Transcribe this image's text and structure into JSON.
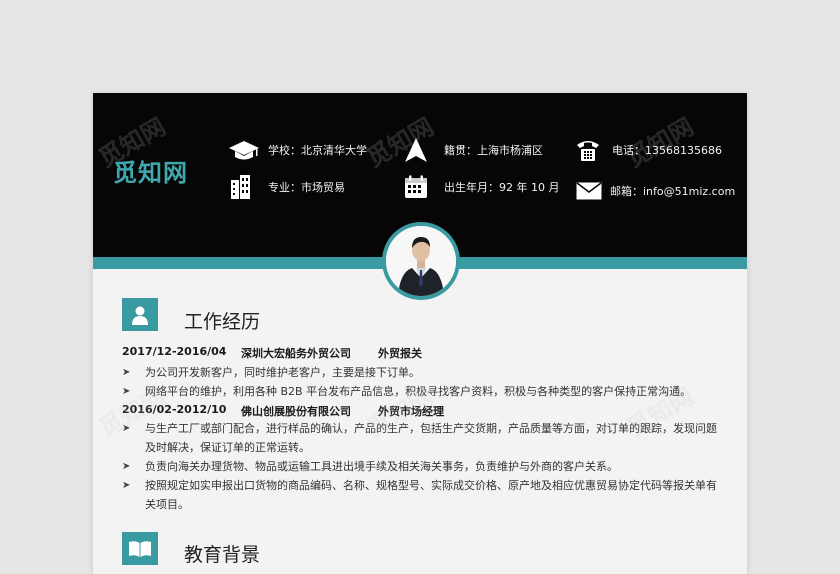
{
  "brand": "觅知网",
  "watermark": "觅知网",
  "info": {
    "school": "学校：北京清华大学",
    "major": "专业：市场贸易",
    "hometown": "籍贯：上海市杨浦区",
    "birth": "出生年月：92 年 10 月",
    "phone": "电话：13568135686",
    "email": "邮箱：info@51miz.com"
  },
  "icons": {
    "school": "graduation-cap-icon",
    "major": "buildings-icon",
    "hometown": "location-arrow-icon",
    "birth": "calendar-icon",
    "phone": "telephone-icon",
    "email": "envelope-icon",
    "work": "person-icon",
    "education": "book-icon"
  },
  "colors": {
    "accent": "#3a9aa1",
    "header": "#060606",
    "brand": "#3fa8ad"
  },
  "work": {
    "title": "工作经历",
    "entries": [
      {
        "period": "2017/12-2016/04",
        "company": "深圳大宏船务外贸公司",
        "position": "外贸报关",
        "bullets": [
          "为公司开发新客户，同时维护老客户，主要是接下订单。",
          "网络平台的维护，利用各种 B2B 平台发布产品信息，积极寻找客户资料，积极与各种类型的客户保持正常沟通。"
        ]
      },
      {
        "period": "2016/02-2012/10",
        "company": "佛山创展股份有限公司",
        "position": "外贸市场经理",
        "bullets": [
          "与生产工厂或部门配合，进行样品的确认，产品的生产，包括生产交货期，产品质量等方面，对订单的跟踪，发现问题及时解决，保证订单的正常运转。",
          "负责向海关办理货物、物品或运输工具进出境手续及相关海关事务，负责维护与外商的客户关系。",
          "按照规定如实申报出口货物的商品编码、名称、规格型号、实际成交价格、原产地及相应优惠贸易协定代码等报关单有关项目。"
        ]
      }
    ]
  },
  "education": {
    "title": "教育背景"
  }
}
